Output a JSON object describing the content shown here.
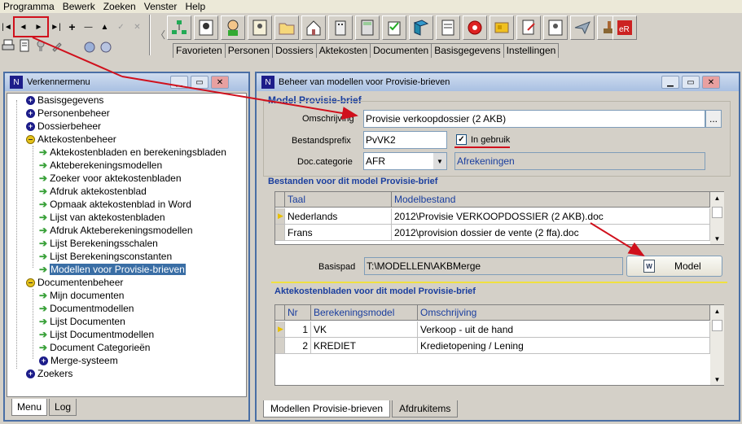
{
  "menu": [
    "Programma",
    "Bewerk",
    "Zoeken",
    "Venster",
    "Help"
  ],
  "nav": {
    "first": "|◄",
    "prev": "◄",
    "next": "►",
    "last": "►|",
    "add": "+",
    "delete": "—",
    "up": "▲",
    "check": "✓",
    "cancel": "✕"
  },
  "tabs": [
    "Favorieten",
    "Personen",
    "Dossiers",
    "Aktekosten",
    "Documenten",
    "Basisgegevens",
    "Instellingen"
  ],
  "explorer": {
    "title": "Verkennermenu",
    "items": [
      "Basisgegevens",
      "Personenbeheer",
      "Dossierbeheer",
      "Aktekostenbeheer",
      "Aktekostenbladen en berekeningsbladen",
      "Akteberekeningsmodellen",
      "Zoeker voor aktekostenbladen",
      "Afdruk aktekostenblad",
      "Opmaak aktekostenblad in Word",
      "Lijst van aktekostenbladen",
      "Afdruk Akteberekeningsmodellen",
      "Lijst Berekeningsschalen",
      "Lijst Berekeningsconstanten",
      "Modellen voor Provisie-brieven",
      "Documentenbeheer",
      "Mijn documenten",
      "Documentmodellen",
      "Lijst Documenten",
      "Lijst Documentmodellen",
      "Document Categorieën",
      "Merge-systeem",
      "Zoekers"
    ],
    "tabs": [
      "Menu",
      "Log"
    ]
  },
  "main": {
    "title": "Beheer van modellen voor Provisie-brieven",
    "group_title": "Model Provisie-brief",
    "omschrijving_label": "Omschrijving",
    "omschrijving_value": "Provisie verkoopdossier (2 AKB)",
    "ellipsis": "...",
    "prefix_label": "Bestandsprefix",
    "prefix_value": "PvVK2",
    "ingebruik_label": "In gebruik",
    "ingebruik_check": "✓",
    "doccat_label": "Doc.categorie",
    "doccat_value": "AFR",
    "doccat_desc": "Afrekeningen",
    "files_title": "Bestanden voor dit model Provisie-brief",
    "files_headers": [
      "Taal",
      "Modelbestand"
    ],
    "files_rows": [
      [
        "Nederlands",
        "2012\\Provisie VERKOOPDOSSIER (2 AKB).doc"
      ],
      [
        "Frans",
        "2012\\provision dossier de vente (2 ffa).doc"
      ]
    ],
    "basispad_label": "Basispad",
    "basispad_value": "T:\\MODELLEN\\AKBMerge",
    "model_button": "Model",
    "ak_title": "Aktekostenbladen voor dit model Provisie-brief",
    "ak_headers": [
      "Nr",
      "Berekeningsmodel",
      "Omschrijving"
    ],
    "ak_rows": [
      [
        "1",
        "VK",
        "Verkoop - uit de hand"
      ],
      [
        "2",
        "KREDIET",
        "Kredietopening / Lening"
      ]
    ],
    "bottom_tabs": [
      "Modellen Provisie-brieven",
      "Afdrukitems"
    ]
  },
  "colors": {
    "accent": "#1a3e9e",
    "highlight_red": "#d0101c",
    "selection": "#3a6ea5"
  }
}
